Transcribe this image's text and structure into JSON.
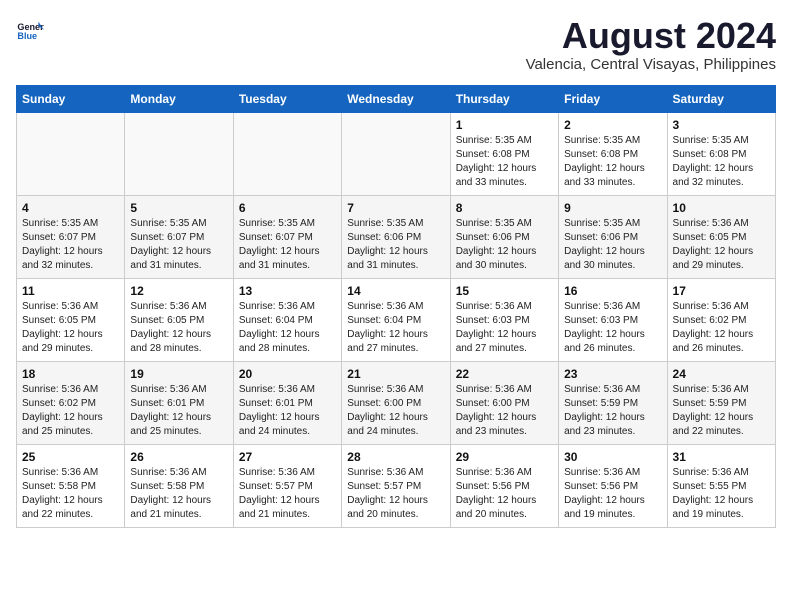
{
  "logo": {
    "line1": "General",
    "line2": "Blue"
  },
  "title": "August 2024",
  "subtitle": "Valencia, Central Visayas, Philippines",
  "days_of_week": [
    "Sunday",
    "Monday",
    "Tuesday",
    "Wednesday",
    "Thursday",
    "Friday",
    "Saturday"
  ],
  "weeks": [
    [
      {
        "day": "",
        "info": ""
      },
      {
        "day": "",
        "info": ""
      },
      {
        "day": "",
        "info": ""
      },
      {
        "day": "",
        "info": ""
      },
      {
        "day": "1",
        "info": "Sunrise: 5:35 AM\nSunset: 6:08 PM\nDaylight: 12 hours\nand 33 minutes."
      },
      {
        "day": "2",
        "info": "Sunrise: 5:35 AM\nSunset: 6:08 PM\nDaylight: 12 hours\nand 33 minutes."
      },
      {
        "day": "3",
        "info": "Sunrise: 5:35 AM\nSunset: 6:08 PM\nDaylight: 12 hours\nand 32 minutes."
      }
    ],
    [
      {
        "day": "4",
        "info": "Sunrise: 5:35 AM\nSunset: 6:07 PM\nDaylight: 12 hours\nand 32 minutes."
      },
      {
        "day": "5",
        "info": "Sunrise: 5:35 AM\nSunset: 6:07 PM\nDaylight: 12 hours\nand 31 minutes."
      },
      {
        "day": "6",
        "info": "Sunrise: 5:35 AM\nSunset: 6:07 PM\nDaylight: 12 hours\nand 31 minutes."
      },
      {
        "day": "7",
        "info": "Sunrise: 5:35 AM\nSunset: 6:06 PM\nDaylight: 12 hours\nand 31 minutes."
      },
      {
        "day": "8",
        "info": "Sunrise: 5:35 AM\nSunset: 6:06 PM\nDaylight: 12 hours\nand 30 minutes."
      },
      {
        "day": "9",
        "info": "Sunrise: 5:35 AM\nSunset: 6:06 PM\nDaylight: 12 hours\nand 30 minutes."
      },
      {
        "day": "10",
        "info": "Sunrise: 5:36 AM\nSunset: 6:05 PM\nDaylight: 12 hours\nand 29 minutes."
      }
    ],
    [
      {
        "day": "11",
        "info": "Sunrise: 5:36 AM\nSunset: 6:05 PM\nDaylight: 12 hours\nand 29 minutes."
      },
      {
        "day": "12",
        "info": "Sunrise: 5:36 AM\nSunset: 6:05 PM\nDaylight: 12 hours\nand 28 minutes."
      },
      {
        "day": "13",
        "info": "Sunrise: 5:36 AM\nSunset: 6:04 PM\nDaylight: 12 hours\nand 28 minutes."
      },
      {
        "day": "14",
        "info": "Sunrise: 5:36 AM\nSunset: 6:04 PM\nDaylight: 12 hours\nand 27 minutes."
      },
      {
        "day": "15",
        "info": "Sunrise: 5:36 AM\nSunset: 6:03 PM\nDaylight: 12 hours\nand 27 minutes."
      },
      {
        "day": "16",
        "info": "Sunrise: 5:36 AM\nSunset: 6:03 PM\nDaylight: 12 hours\nand 26 minutes."
      },
      {
        "day": "17",
        "info": "Sunrise: 5:36 AM\nSunset: 6:02 PM\nDaylight: 12 hours\nand 26 minutes."
      }
    ],
    [
      {
        "day": "18",
        "info": "Sunrise: 5:36 AM\nSunset: 6:02 PM\nDaylight: 12 hours\nand 25 minutes."
      },
      {
        "day": "19",
        "info": "Sunrise: 5:36 AM\nSunset: 6:01 PM\nDaylight: 12 hours\nand 25 minutes."
      },
      {
        "day": "20",
        "info": "Sunrise: 5:36 AM\nSunset: 6:01 PM\nDaylight: 12 hours\nand 24 minutes."
      },
      {
        "day": "21",
        "info": "Sunrise: 5:36 AM\nSunset: 6:00 PM\nDaylight: 12 hours\nand 24 minutes."
      },
      {
        "day": "22",
        "info": "Sunrise: 5:36 AM\nSunset: 6:00 PM\nDaylight: 12 hours\nand 23 minutes."
      },
      {
        "day": "23",
        "info": "Sunrise: 5:36 AM\nSunset: 5:59 PM\nDaylight: 12 hours\nand 23 minutes."
      },
      {
        "day": "24",
        "info": "Sunrise: 5:36 AM\nSunset: 5:59 PM\nDaylight: 12 hours\nand 22 minutes."
      }
    ],
    [
      {
        "day": "25",
        "info": "Sunrise: 5:36 AM\nSunset: 5:58 PM\nDaylight: 12 hours\nand 22 minutes."
      },
      {
        "day": "26",
        "info": "Sunrise: 5:36 AM\nSunset: 5:58 PM\nDaylight: 12 hours\nand 21 minutes."
      },
      {
        "day": "27",
        "info": "Sunrise: 5:36 AM\nSunset: 5:57 PM\nDaylight: 12 hours\nand 21 minutes."
      },
      {
        "day": "28",
        "info": "Sunrise: 5:36 AM\nSunset: 5:57 PM\nDaylight: 12 hours\nand 20 minutes."
      },
      {
        "day": "29",
        "info": "Sunrise: 5:36 AM\nSunset: 5:56 PM\nDaylight: 12 hours\nand 20 minutes."
      },
      {
        "day": "30",
        "info": "Sunrise: 5:36 AM\nSunset: 5:56 PM\nDaylight: 12 hours\nand 19 minutes."
      },
      {
        "day": "31",
        "info": "Sunrise: 5:36 AM\nSunset: 5:55 PM\nDaylight: 12 hours\nand 19 minutes."
      }
    ]
  ]
}
